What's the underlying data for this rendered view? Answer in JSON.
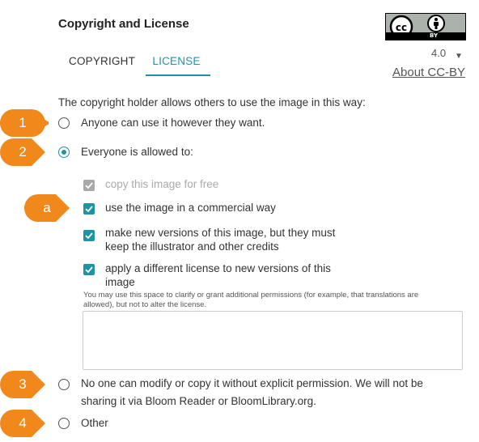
{
  "header": {
    "title": "Copyright and License",
    "tabs": [
      {
        "label": "COPYRIGHT",
        "active": false
      },
      {
        "label": "LICENSE",
        "active": true
      }
    ]
  },
  "license_badge": {
    "icon": "cc-by-badge",
    "by_text": "BY",
    "version": "4.0",
    "about_link": "About CC-BY"
  },
  "intro": "The copyright holder allows others to use the image in this way:",
  "options": [
    {
      "label": "Anyone can use it however they want.",
      "selected": false
    },
    {
      "label": "Everyone is allowed to:",
      "selected": true
    },
    {
      "label_line1": "No one can modify or copy it without explicit permission. We will not be",
      "label_line2": "sharing it via Bloom Reader or BloomLibrary.org.",
      "selected": false
    },
    {
      "label": "Other",
      "selected": false
    }
  ],
  "permissions": [
    {
      "label": "copy this image for free",
      "checked": true,
      "disabled": true
    },
    {
      "label": "use the image in a commercial way",
      "checked": true,
      "disabled": false
    },
    {
      "label_line1": "make new versions of this image, but they must",
      "label_line2": "keep the illustrator and other credits",
      "checked": true,
      "disabled": false
    },
    {
      "label_line1": "apply a different license to new versions of this",
      "label_line2": "image",
      "checked": true,
      "disabled": false
    }
  ],
  "additional": {
    "hint_line1": "You may use this space to clarify or grant additional permissions (for example, that translations are",
    "hint_line2": "allowed), but not to alter the license.",
    "value": ""
  },
  "callouts": [
    "1",
    "2",
    "3",
    "4",
    "a"
  ],
  "colors": {
    "accent": "#1d94a4",
    "callout": "#f0881b",
    "disabled": "#a9a9a9"
  }
}
